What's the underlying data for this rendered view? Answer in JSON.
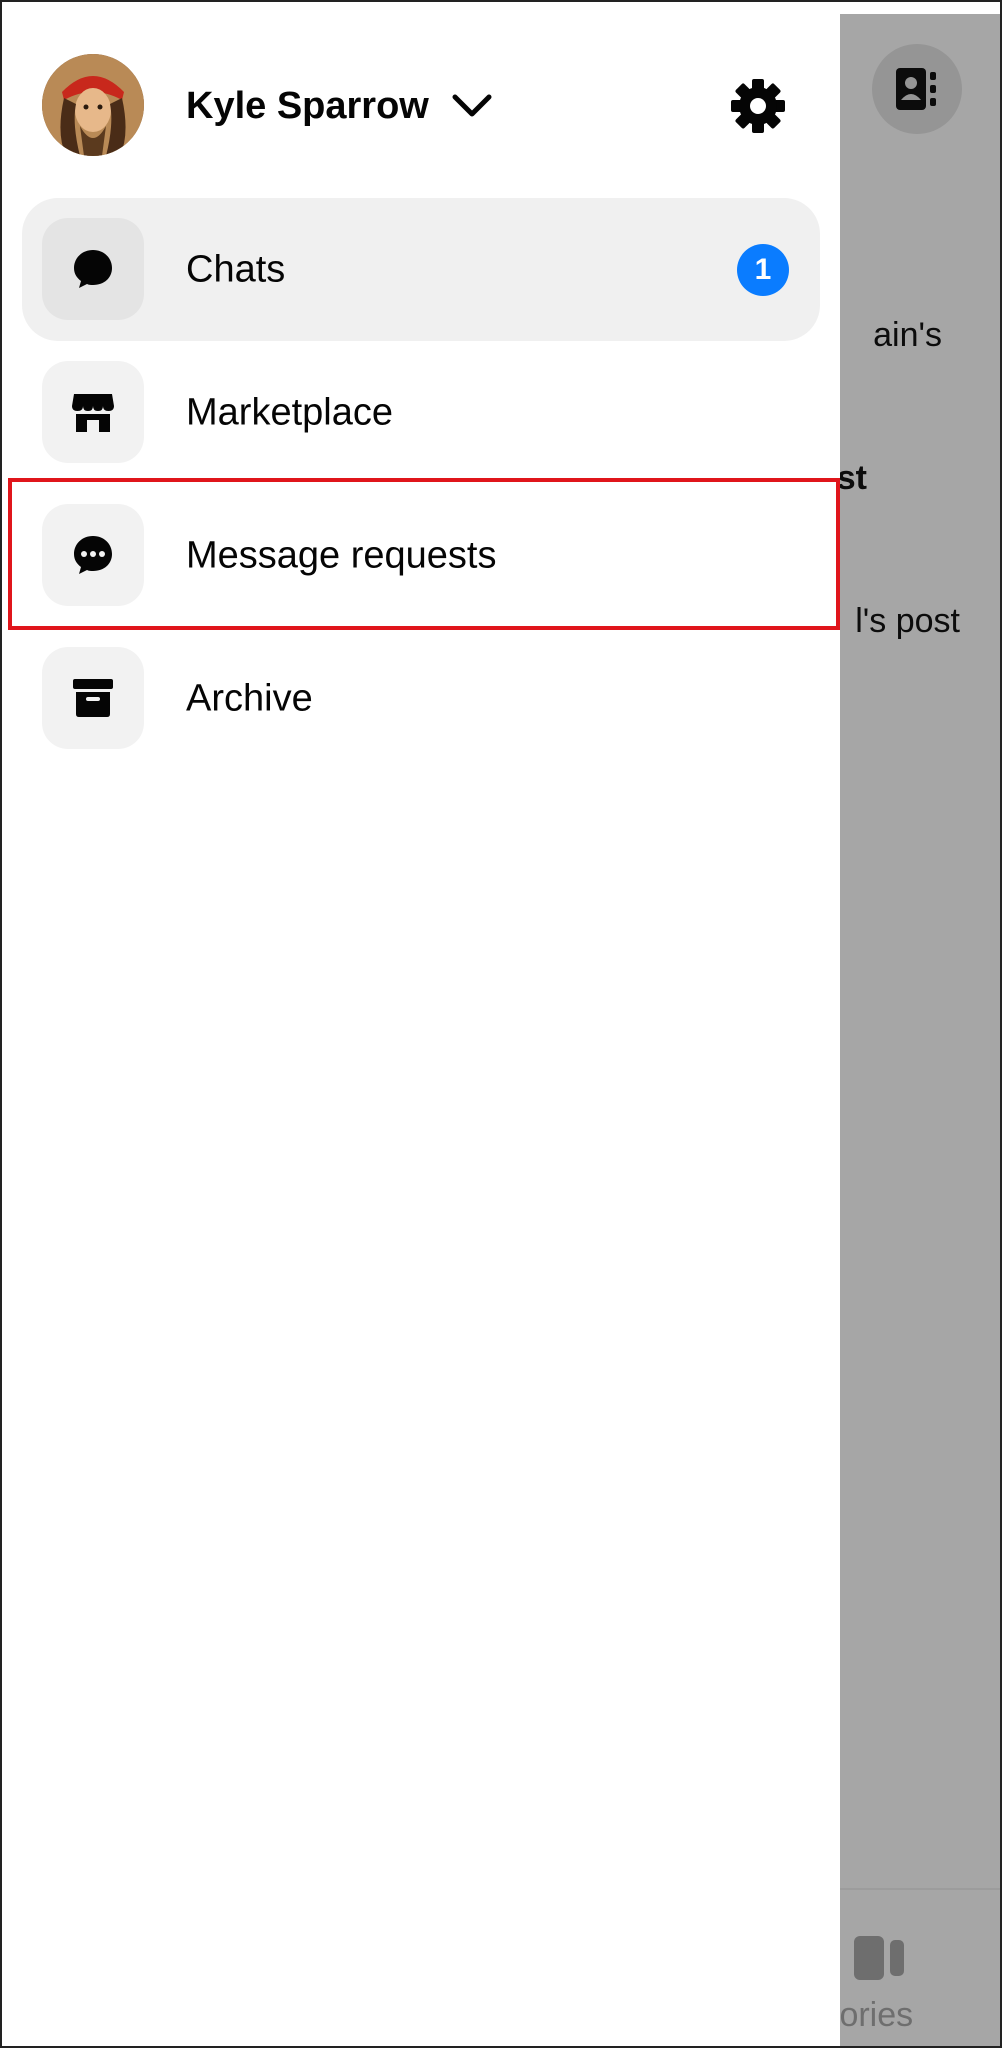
{
  "user": {
    "name": "Kyle Sparrow"
  },
  "menu": {
    "items": [
      {
        "label": "Chats",
        "icon": "chat-bubble-icon",
        "badge": "1",
        "active": true
      },
      {
        "label": "Marketplace",
        "icon": "storefront-icon",
        "active": false
      },
      {
        "label": "Message requests",
        "icon": "message-requests-icon",
        "active": false,
        "highlighted": true
      },
      {
        "label": "Archive",
        "icon": "archive-box-icon",
        "active": false
      }
    ]
  },
  "background": {
    "snippets": [
      "ain's",
      "st",
      "l's post"
    ],
    "bottom_nav": {
      "stories_label": "tories"
    }
  },
  "colors": {
    "badge": "#0a7cff",
    "highlight": "#e0151b",
    "overlay": "#a6a6a6"
  }
}
